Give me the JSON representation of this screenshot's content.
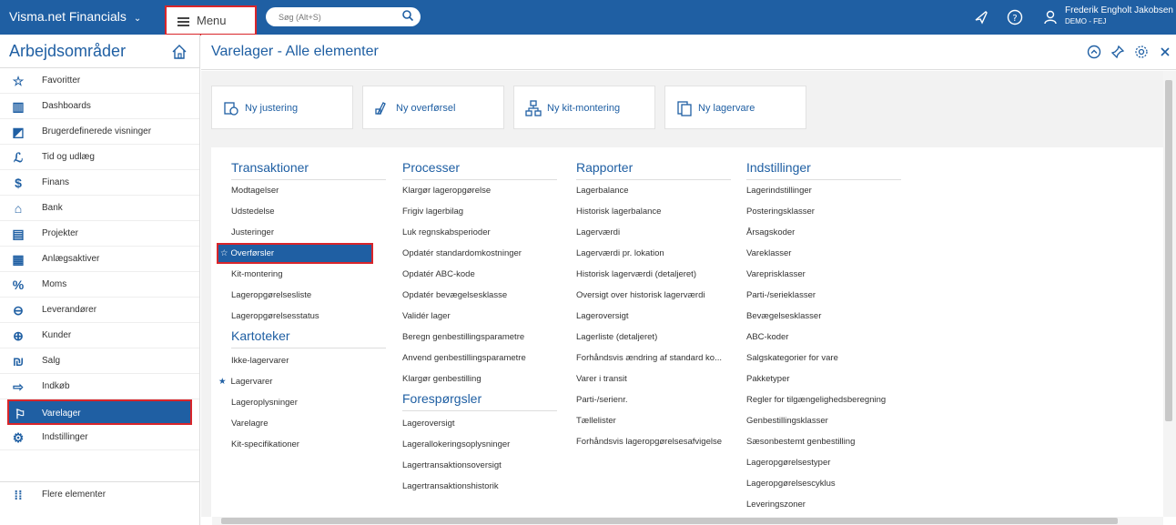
{
  "topbar": {
    "brand": "Visma.net Financials",
    "menu_label": "Menu",
    "search_placeholder": "Søg (Alt+S)",
    "user_name": "Frederik Engholt Jakobsen",
    "user_org": "DEMO - FEJ"
  },
  "sidebar": {
    "title": "Arbejdsområder",
    "items": [
      {
        "label": "Favoritter",
        "icon": "star-icon"
      },
      {
        "label": "Dashboards",
        "icon": "bar-chart-icon"
      },
      {
        "label": "Brugerdefinerede visninger",
        "icon": "custom-view-icon"
      },
      {
        "label": "Tid og udlæg",
        "icon": "time-expense-icon"
      },
      {
        "label": "Finans",
        "icon": "finance-icon"
      },
      {
        "label": "Bank",
        "icon": "bank-icon"
      },
      {
        "label": "Projekter",
        "icon": "projects-icon"
      },
      {
        "label": "Anlægsaktiver",
        "icon": "assets-icon"
      },
      {
        "label": "Moms",
        "icon": "percent-icon"
      },
      {
        "label": "Leverandører",
        "icon": "minus-circle-icon"
      },
      {
        "label": "Kunder",
        "icon": "plus-circle-icon"
      },
      {
        "label": "Salg",
        "icon": "sales-icon"
      },
      {
        "label": "Indkøb",
        "icon": "purchase-icon"
      },
      {
        "label": "Varelager",
        "icon": "inventory-icon"
      },
      {
        "label": "Indstillinger",
        "icon": "gear-icon"
      }
    ],
    "more_label": "Flere elementer"
  },
  "main": {
    "title": "Varelager - Alle elementer",
    "quick_actions": [
      {
        "label": "Ny justering"
      },
      {
        "label": "Ny overførsel"
      },
      {
        "label": "Ny kit-montering"
      },
      {
        "label": "Ny lagervare"
      }
    ],
    "columns": {
      "transaktioner": {
        "title": "Transaktioner",
        "links": [
          "Modtagelser",
          "Udstedelse",
          "Justeringer",
          "Overførsler",
          "Kit-montering",
          "Lageropgørelsesliste",
          "Lageropgørelsesstatus"
        ]
      },
      "kartoteker": {
        "title": "Kartoteker",
        "links": [
          "Ikke-lagervarer",
          "Lagervarer",
          "Lageroplysninger",
          "Varelagre",
          "Kit-specifikationer"
        ]
      },
      "processer": {
        "title": "Processer",
        "links": [
          "Klargør lageropgørelse",
          "Frigiv lagerbilag",
          "Luk regnskabsperioder",
          "Opdatér standardomkostninger",
          "Opdatér ABC-kode",
          "Opdatér bevægelsesklasse",
          "Validér lager",
          "Beregn genbestillingsparametre",
          "Anvend genbestillingsparametre",
          "Klargør genbestilling"
        ]
      },
      "forespoergsler": {
        "title": "Forespørgsler",
        "links": [
          "Lageroversigt",
          "Lagerallokeringsoplysninger",
          "Lagertransaktionsoversigt",
          "Lagertransaktionshistorik"
        ]
      },
      "rapporter": {
        "title": "Rapporter",
        "links": [
          "Lagerbalance",
          "Historisk lagerbalance",
          "Lagerværdi",
          "Lagerværdi pr. lokation",
          "Historisk lagerværdi (detaljeret)",
          "Oversigt over historisk lagerværdi",
          "Lageroversigt",
          "Lagerliste (detaljeret)",
          "Forhåndsvis ændring af standard ko...",
          "Varer i transit",
          "Parti-/serienr.",
          "Tællelister",
          "Forhåndsvis lageropgørelsesafvigelse"
        ]
      },
      "indstillinger": {
        "title": "Indstillinger",
        "links": [
          "Lagerindstillinger",
          "Posteringsklasser",
          "Årsagskoder",
          "Vareklasser",
          "Vareprisklasser",
          "Parti-/serieklasser",
          "Bevægelsesklasser",
          "ABC-koder",
          "Salgskategorier for vare",
          "Pakketyper",
          "Regler for tilgængelighedsberegning",
          "Genbestillingsklasser",
          "Sæsonbestemt genbestilling",
          "Lageropgørelsestyper",
          "Lageropgørelsescyklus",
          "Leveringszoner"
        ]
      }
    }
  },
  "colors": {
    "brand": "#1f5fa3",
    "highlight": "#d9252a"
  }
}
